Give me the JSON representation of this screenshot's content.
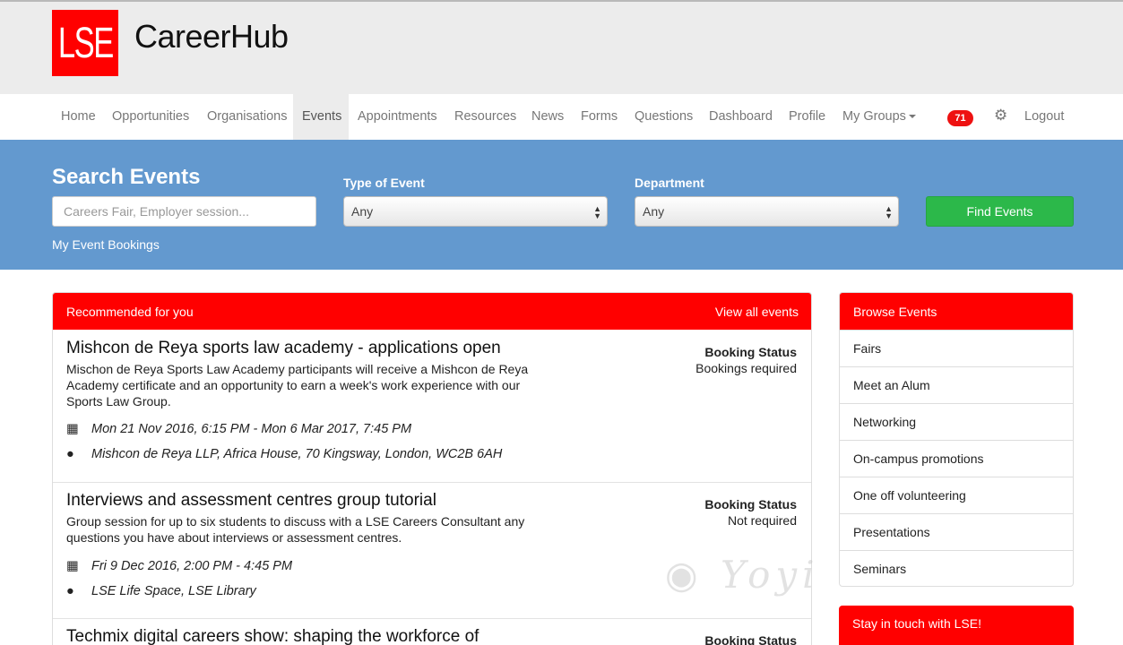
{
  "brand": {
    "logo_text": "LSE",
    "site_title": "CareerHub",
    "brand_red": "#ff0000",
    "band_blue": "#6399cf",
    "button_green": "#2cb84a"
  },
  "nav": {
    "items": [
      "Home",
      "Opportunities",
      "Organisations",
      "Events",
      "Appointments",
      "Resources",
      "News",
      "Forms",
      "Questions",
      "Dashboard",
      "Profile",
      "My Groups"
    ],
    "active": "Events",
    "notification_count": "71",
    "settings_icon": "gear-icon",
    "logout": "Logout"
  },
  "search": {
    "title": "Search Events",
    "keyword_placeholder": "Careers Fair, Employer session...",
    "type_label": "Type of Event",
    "type_value": "Any",
    "department_label": "Department",
    "department_value": "Any",
    "button": "Find Events",
    "my_bookings": "My Event Bookings"
  },
  "recommended": {
    "title": "Recommended for you",
    "view_all": "View all events",
    "events": [
      {
        "title": "Mishcon de Reya sports law academy - applications open",
        "description": "Mischon de Reya Sports Law Academy participants will receive a Mishcon de Reya Academy certificate and an opportunity to earn a week's work experience with our Sports Law Group.",
        "date": "Mon 21 Nov 2016, 6:15 PM - Mon 6 Mar 2017, 7:45 PM",
        "location": "Mishcon de Reya LLP, Africa House, 70 Kingsway, London, WC2B 6AH",
        "status_label": "Booking Status",
        "status_value": "Bookings required"
      },
      {
        "title": "Interviews and assessment centres group tutorial",
        "description": "Group session for up to six students to discuss with a LSE Careers Consultant any questions you have about interviews or assessment centres.",
        "date": "Fri 9 Dec 2016, 2:00 PM - 4:45 PM",
        "location": "LSE Life Space, LSE Library",
        "status_label": "Booking Status",
        "status_value": "Not required"
      },
      {
        "title": "Techmix digital careers show: shaping the workforce of",
        "status_label": "Booking Status"
      }
    ]
  },
  "browse": {
    "title": "Browse Events",
    "items": [
      "Fairs",
      "Meet an Alum",
      "Networking",
      "On-campus promotions",
      "One off volunteering",
      "Presentations",
      "Seminars"
    ]
  },
  "stay_in_touch": "Stay in touch with LSE!",
  "watermark": "Yoyi"
}
